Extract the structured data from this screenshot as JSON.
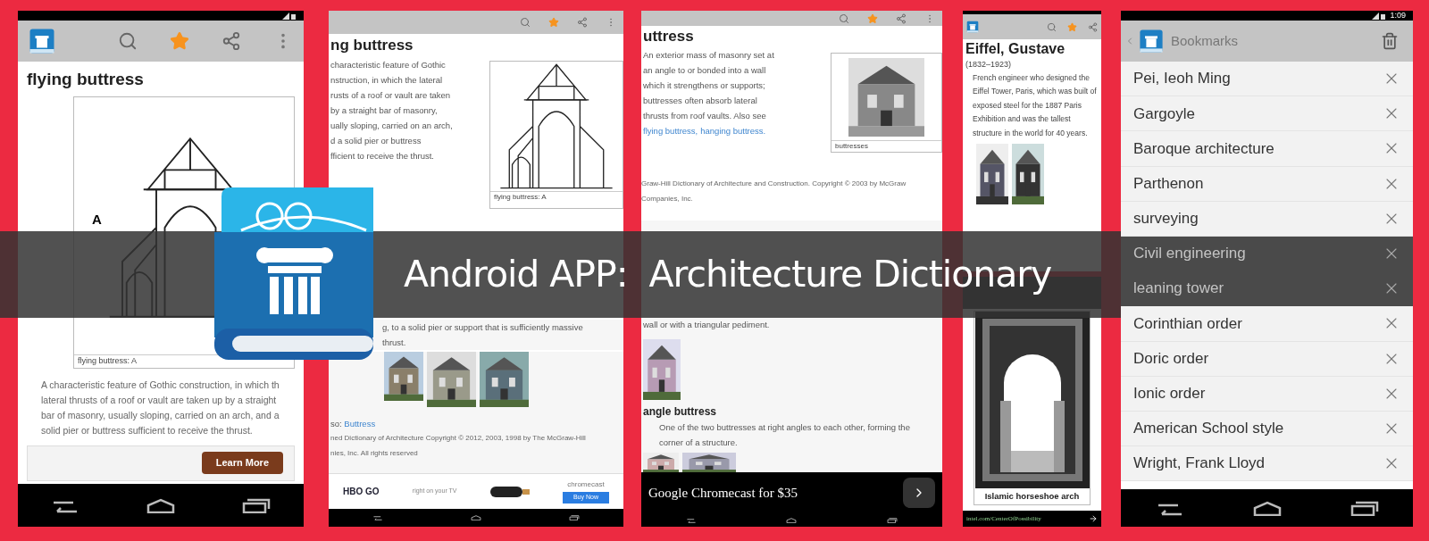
{
  "banner": {
    "title": "Android APP:  Architecture Dictionary"
  },
  "phone_entry": {
    "starred": true,
    "title": "flying buttress",
    "figure_label": "A",
    "caption": "flying buttress: A",
    "paragraph_lines": [
      "A characteristic feature of Gothic construction, in which th",
      "lateral thrusts of a roof or vault are taken up by a straight",
      "bar of masonry, usually sloping, carried on an arch, and a",
      "solid pier or buttress sufficient to receive the thrust."
    ],
    "ad_button": "Learn More"
  },
  "tablet_entry": {
    "starred": true,
    "title": "ng buttress",
    "lines": [
      "characteristic feature of Gothic",
      "nstruction, in which the lateral",
      "rusts of a roof or vault are taken",
      "by a straight bar of masonry,",
      "ually sloping, carried on an arch,",
      "d a solid pier or buttress",
      "fficient to receive the thrust."
    ],
    "caption": "flying buttress: A",
    "section_lines": [
      "g, to a solid pier or support that is sufficiently massive",
      "thrust."
    ],
    "see_also_prefix": "so: ",
    "see_also_link": "Buttress",
    "copyright_lines": [
      "ned Dictionary of Architecture Copyright © 2012, 2003, 1998 by The McGraw-Hill",
      "nies, Inc. All rights reserved"
    ],
    "ad": {
      "brand": "HBO GO",
      "tagline": "right on your TV",
      "product": "chromecast",
      "button": "Buy Now"
    }
  },
  "tablet_buttress": {
    "starred": true,
    "title": "uttress",
    "lines": [
      "An exterior mass of masonry set at",
      "an angle to or bonded into a wall",
      "which it strengthens or supports;",
      "buttresses often absorb lateral",
      "thrusts from roof vaults. Also see"
    ],
    "links": [
      "flying buttress,",
      "hanging buttress."
    ],
    "caption": "buttresses",
    "source_lines": [
      "Graw-Hill Dictionary of Architecture and Construction. Copyright © 2003 by McGraw",
      "Companies, Inc."
    ],
    "second_lines": [
      "wall or with a triangular pediment."
    ],
    "third_title": "angle buttress",
    "third_text": "One of the two buttresses at right angles to each other, forming the corner of a structure.",
    "ad_title": "Google Chromecast for $35"
  },
  "eiffel": {
    "starred": true,
    "title": "Eiffel, Gustave",
    "dates": "(1832–1923)",
    "text": "French engineer who designed the Eiffel Tower, Paris, which was built of exposed steel for the 1887 Paris Exhibition and was the tallest structure in the world for 40 years."
  },
  "arch": {
    "caption": "Islamic horseshoe arch",
    "ad_link": "intel.com/CenterOfPossibility"
  },
  "bookmarks": {
    "time": "1:09",
    "title": "Bookmarks",
    "items": [
      "Pei, Ieoh Ming",
      "Gargoyle",
      "Baroque architecture",
      "Parthenon",
      "surveying",
      "Civil engineering",
      "leaning tower",
      "Corinthian order",
      "Doric order",
      "Ionic order",
      "American School style",
      "Wright, Frank Lloyd"
    ]
  }
}
